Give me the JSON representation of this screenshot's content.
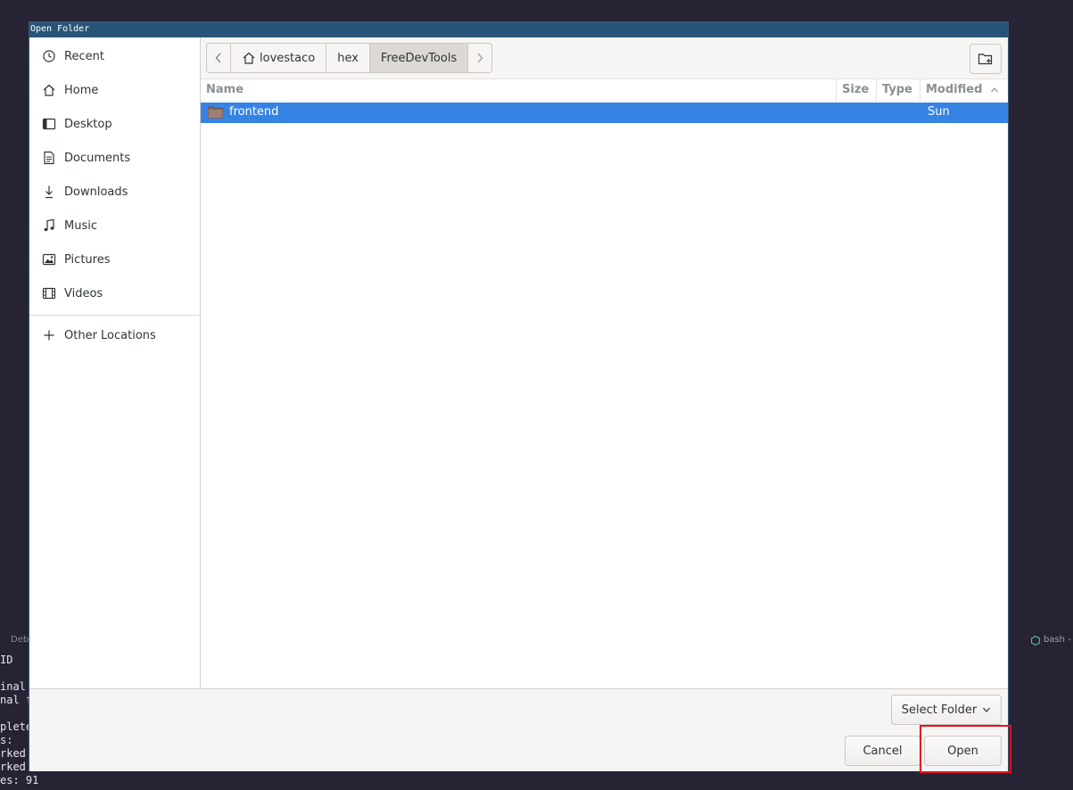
{
  "window": {
    "title": "Open Folder"
  },
  "sidebar": {
    "items": [
      {
        "label": "Recent",
        "icon": "clock-icon"
      },
      {
        "label": "Home",
        "icon": "home-icon"
      },
      {
        "label": "Desktop",
        "icon": "desktop-icon"
      },
      {
        "label": "Documents",
        "icon": "document-icon"
      },
      {
        "label": "Downloads",
        "icon": "download-icon"
      },
      {
        "label": "Music",
        "icon": "music-icon"
      },
      {
        "label": "Pictures",
        "icon": "picture-icon"
      },
      {
        "label": "Videos",
        "icon": "video-icon"
      }
    ],
    "other": {
      "label": "Other Locations",
      "icon": "plus-icon"
    }
  },
  "pathbar": {
    "crumbs": [
      "lovestaco",
      "hex",
      "FreeDevTools"
    ],
    "active": "FreeDevTools"
  },
  "columns": {
    "name": "Name",
    "size": "Size",
    "type": "Type",
    "modified": "Modified"
  },
  "files": [
    {
      "name": "frontend",
      "size": "",
      "type": "",
      "modified": "Sun",
      "selected": true
    }
  ],
  "footer": {
    "filter_label": "Select Folder",
    "cancel_label": "Cancel",
    "open_label": "Open"
  },
  "background_terminal": {
    "left_bar": "Deb",
    "right_bar": "bash -",
    "lines": [
      " ID",
      "",
      "inal",
      "nal f",
      "",
      "plete",
      "s:",
      "rked",
      "rked",
      "es: 91"
    ]
  },
  "colors": {
    "selection": "#3584e4",
    "titlebar": "#285577",
    "highlight": "#e8101a",
    "desktop_bg": "#262335"
  }
}
